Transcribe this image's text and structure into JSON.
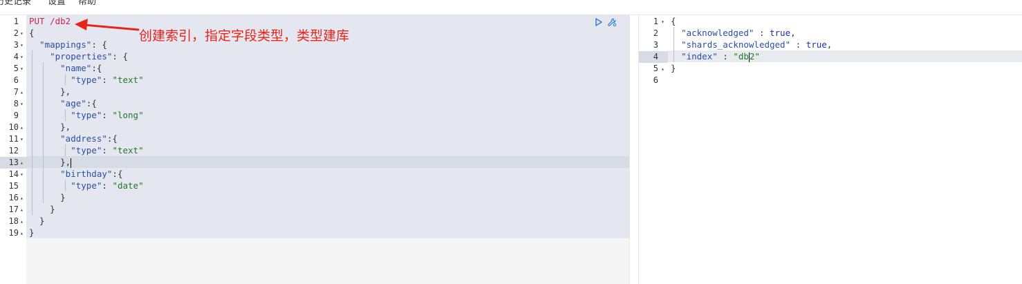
{
  "menu": {
    "items": [
      {
        "label": "历史记录"
      },
      {
        "label": "设置"
      },
      {
        "label": "帮助"
      }
    ]
  },
  "request": {
    "method": "PUT",
    "path": "/db2",
    "line_numbers": [
      "1",
      "2",
      "3",
      "4",
      "5",
      "6",
      "7",
      "8",
      "9",
      "10",
      "11",
      "12",
      "13",
      "14",
      "15",
      "16",
      "17",
      "18",
      "19"
    ],
    "folds": [
      "",
      "▾",
      "▾",
      "▾",
      "▾",
      "",
      "▴",
      "▾",
      "",
      "▴",
      "▾",
      "",
      "▴",
      "▾",
      "",
      "▴",
      "▴",
      "▴",
      "▴"
    ],
    "active_line": 13
  },
  "annotation": {
    "text": "创建索引，指定字段类型，类型建库",
    "color": "#e8231a"
  },
  "response": {
    "line_numbers": [
      "1",
      "2",
      "3",
      "4",
      "5",
      "6"
    ],
    "folds": [
      "▾",
      "",
      "",
      "",
      "▴",
      ""
    ],
    "active_line": 4
  },
  "colors": {
    "key": "#2a4fa0",
    "string": "#1f7a2a",
    "boolean": "#1b2fb0",
    "method": "#c7254e"
  }
}
